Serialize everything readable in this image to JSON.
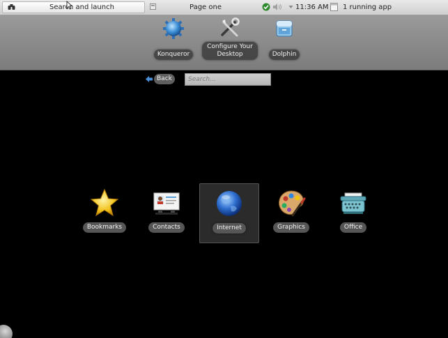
{
  "top_panel": {
    "search_launch_label": "Search and launch",
    "page_label": "Page one",
    "clock": "11:36 AM",
    "running_apps": "1 running app"
  },
  "favorites": [
    {
      "label": "Konqueror",
      "icon": "konqueror-icon"
    },
    {
      "label": "Configure Your Desktop",
      "icon": "configure-desktop-icon"
    },
    {
      "label": "Dolphin",
      "icon": "dolphin-icon"
    }
  ],
  "nav": {
    "back_label": "Back",
    "search_placeholder": "Search..."
  },
  "categories": [
    {
      "label": "Bookmarks",
      "icon": "star-icon"
    },
    {
      "label": "Contacts",
      "icon": "contacts-card-icon"
    },
    {
      "label": "Internet",
      "icon": "globe-icon",
      "selected": true
    },
    {
      "label": "Graphics",
      "icon": "palette-icon"
    },
    {
      "label": "Office",
      "icon": "typewriter-icon"
    }
  ],
  "colors": {
    "panel_bg": "#d9d9d9",
    "favorites_bg": "#8a8a8a",
    "background": "#000000",
    "selection_bg": "#2b2b2b"
  }
}
